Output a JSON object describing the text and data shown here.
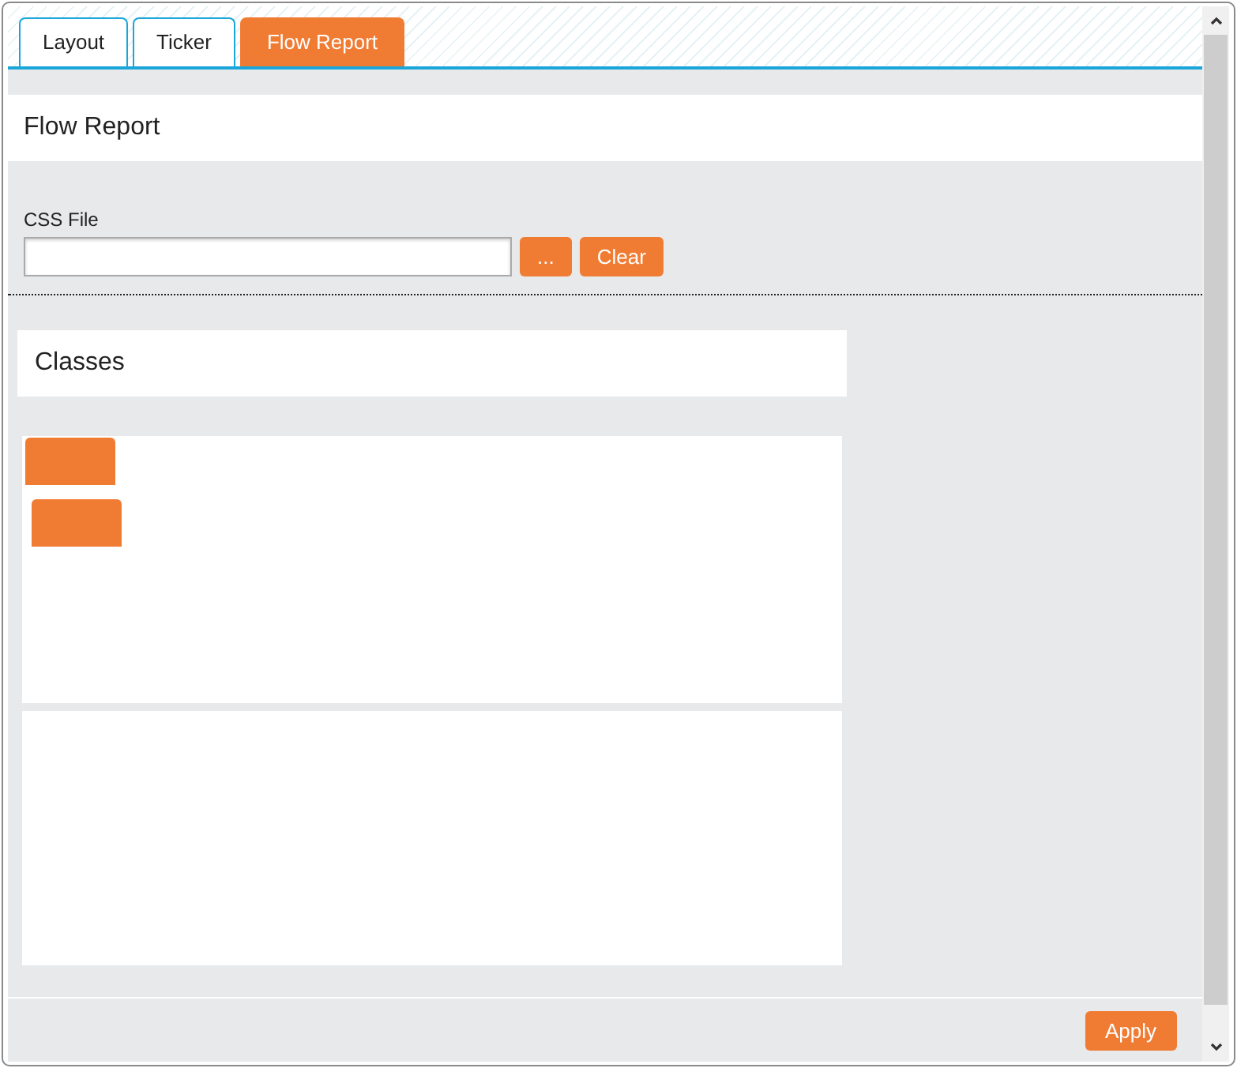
{
  "tabs": [
    {
      "label": "Layout",
      "selected": false
    },
    {
      "label": "Ticker",
      "selected": false
    },
    {
      "label": "Flow Report",
      "selected": true
    }
  ],
  "panel_title": "Flow Report",
  "css_file": {
    "label": "CSS File",
    "browse_button": "...",
    "clear_button": "Clear"
  },
  "classes": {
    "title": "Classes"
  },
  "apply_button": "Apply"
}
